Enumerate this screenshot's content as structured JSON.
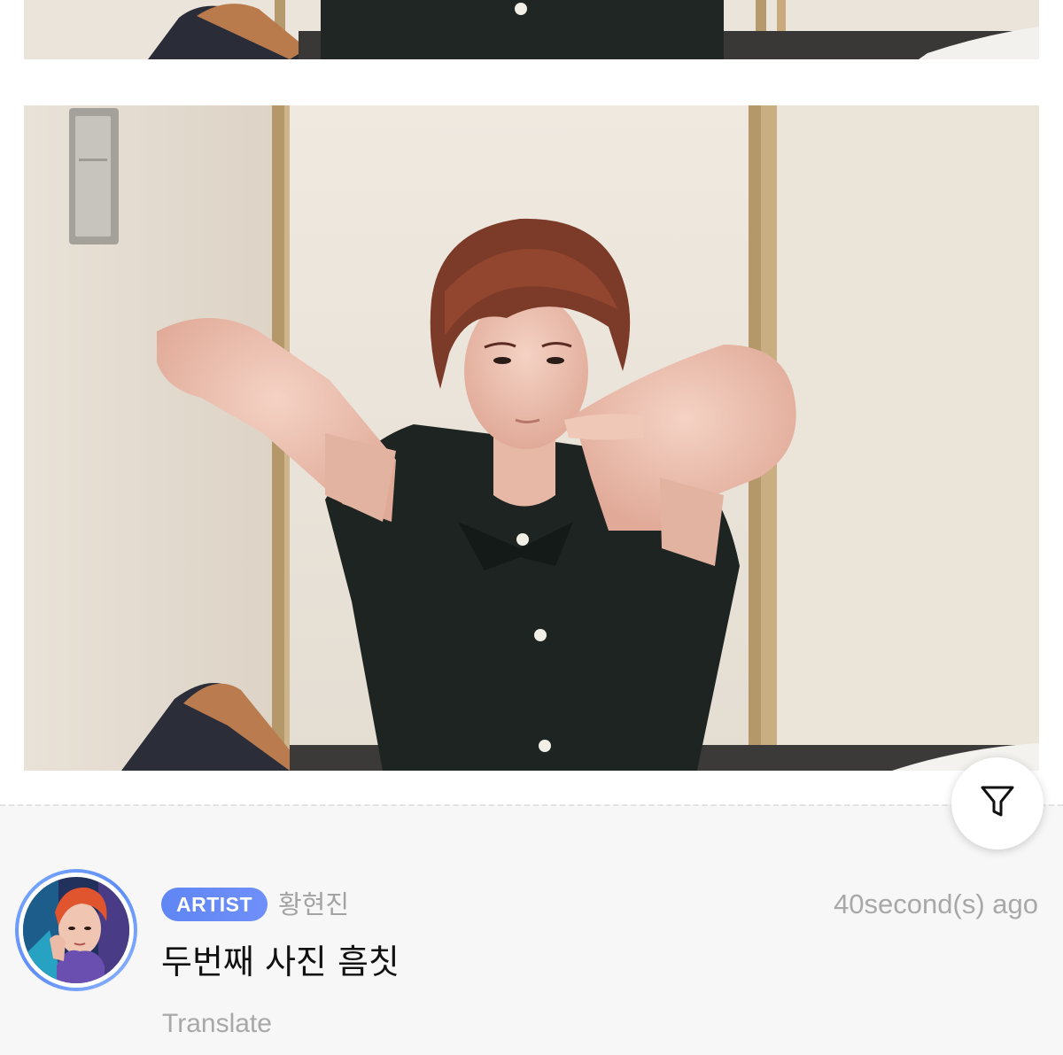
{
  "post": {
    "images": [
      {
        "alt_role": "photo-partial-top"
      },
      {
        "alt_role": "photo-main"
      }
    ]
  },
  "filter": {
    "icon": "filter-funnel-icon"
  },
  "comment": {
    "badge": "ARTIST",
    "author": "황현진",
    "time": "40second(s) ago",
    "text": "두번째 사진 흠칫",
    "translate_label": "Translate"
  },
  "colors": {
    "badge": "#6688f6",
    "avatar_ring": "#6d98fa",
    "muted_text": "#a8a8a8",
    "comment_bg": "#f7f7f7"
  }
}
